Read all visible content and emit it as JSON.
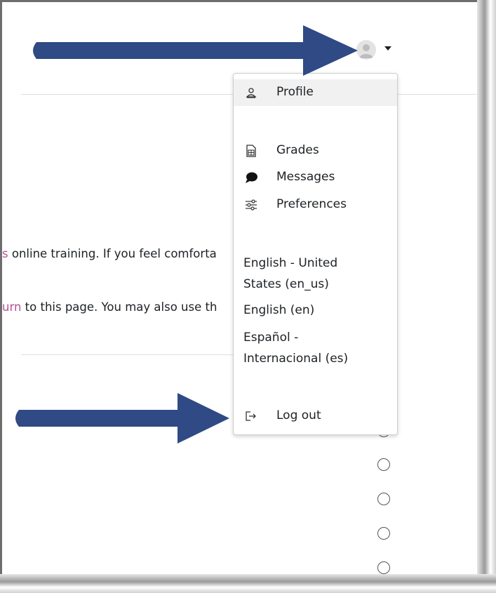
{
  "header": {
    "avatar_icon": "user-avatar-icon",
    "menu_toggle_icon": "caret-down-icon"
  },
  "user_menu": {
    "items": [
      {
        "label": "Profile",
        "icon": "user-icon"
      },
      {
        "label": "Grades",
        "icon": "grades-icon"
      },
      {
        "label": "Messages",
        "icon": "chat-bubble-icon"
      },
      {
        "label": "Preferences",
        "icon": "sliders-icon"
      }
    ],
    "languages": [
      {
        "label_line1": "English - United",
        "label_line2": "States (en_us)"
      },
      {
        "label_line1": "English (en)"
      },
      {
        "label_line1": "Español -",
        "label_line2": "Internacional (es)"
      }
    ],
    "logout": {
      "label": "Log out",
      "icon": "logout-icon"
    }
  },
  "page": {
    "line1_prefix": "s",
    "line1_text": " online training. If you feel comforta",
    "line2_prefix": "urn",
    "line2_text": " to this page. You may also use th"
  },
  "annotations": {
    "arrow_color": "#2f4a84"
  },
  "colors": {
    "text": "#1d2125",
    "link": "#b4519a",
    "menu_active_bg": "#f1f1f1"
  }
}
